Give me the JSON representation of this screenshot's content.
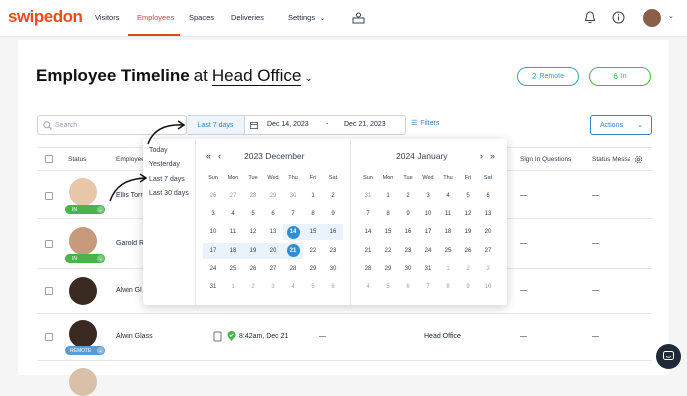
{
  "nav": {
    "logo": "swipedon",
    "items": [
      "Visitors",
      "Employees",
      "Spaces",
      "Deliveries",
      "Settings"
    ],
    "active": "Employees",
    "icons": [
      "reception-icon",
      "bell-icon",
      "info-icon",
      "user-avatar"
    ]
  },
  "page": {
    "title": "Employee Timeline",
    "at": "at",
    "location": "Head Office",
    "remote_count": "2",
    "remote_label": "Remote",
    "in_count": "6",
    "in_label": "In"
  },
  "toolbar": {
    "search_placeholder": "Search",
    "range_preset": "Last 7 days",
    "start_date": "Dec 14, 2023",
    "end_date": "Dec 21, 2023",
    "range_separator": "-",
    "filters": "Filters",
    "actions": "Actions"
  },
  "table": {
    "headers": [
      "Status",
      "Employee",
      "Sign In Questions",
      "Status Message"
    ],
    "rows": [
      {
        "status": "IN",
        "name": "Ellis Torr",
        "questions": "—",
        "message": "—"
      },
      {
        "status": "IN",
        "name": "Garold R",
        "questions": "—",
        "message": "—"
      },
      {
        "status": "",
        "name": "Alwin Gl",
        "questions": "—",
        "message": "—"
      },
      {
        "status": "REMOTE",
        "name": "Alwin Glass",
        "time": "8:42am, Dec 21",
        "dash": "—",
        "location": "Head Office",
        "questions": "—",
        "message": "—"
      }
    ]
  },
  "datepicker": {
    "presets": [
      "Today",
      "Yesterday",
      "Last 7 days",
      "Last 30 days"
    ],
    "weekdays": [
      "Sun",
      "Mon",
      "Tue",
      "Wed",
      "Thu",
      "Fri",
      "Sat"
    ],
    "left_month": "2023 December",
    "right_month": "2024 January",
    "left_days": [
      [
        "26",
        "27",
        "28",
        "29",
        "30",
        "1",
        "2"
      ],
      [
        "3",
        "4",
        "5",
        "6",
        "7",
        "8",
        "9"
      ],
      [
        "10",
        "11",
        "12",
        "13",
        "14",
        "15",
        "16"
      ],
      [
        "17",
        "18",
        "19",
        "20",
        "21",
        "22",
        "23"
      ],
      [
        "24",
        "25",
        "26",
        "27",
        "28",
        "29",
        "30"
      ],
      [
        "31",
        "1",
        "2",
        "3",
        "4",
        "5",
        "6"
      ]
    ],
    "right_days": [
      [
        "31",
        "1",
        "2",
        "3",
        "4",
        "5",
        "6"
      ],
      [
        "7",
        "8",
        "9",
        "10",
        "11",
        "12",
        "13"
      ],
      [
        "14",
        "15",
        "16",
        "17",
        "18",
        "19",
        "20"
      ],
      [
        "21",
        "22",
        "23",
        "24",
        "25",
        "26",
        "27"
      ],
      [
        "28",
        "29",
        "30",
        "31",
        "1",
        "2",
        "3"
      ],
      [
        "4",
        "5",
        "6",
        "7",
        "8",
        "9",
        "10"
      ]
    ],
    "selected_start": "14",
    "selected_end": "21"
  },
  "colors": {
    "brand": "#f24a1d",
    "accent": "#2f8fd1",
    "in": "#47b54a",
    "remote": "#2da8b8"
  }
}
